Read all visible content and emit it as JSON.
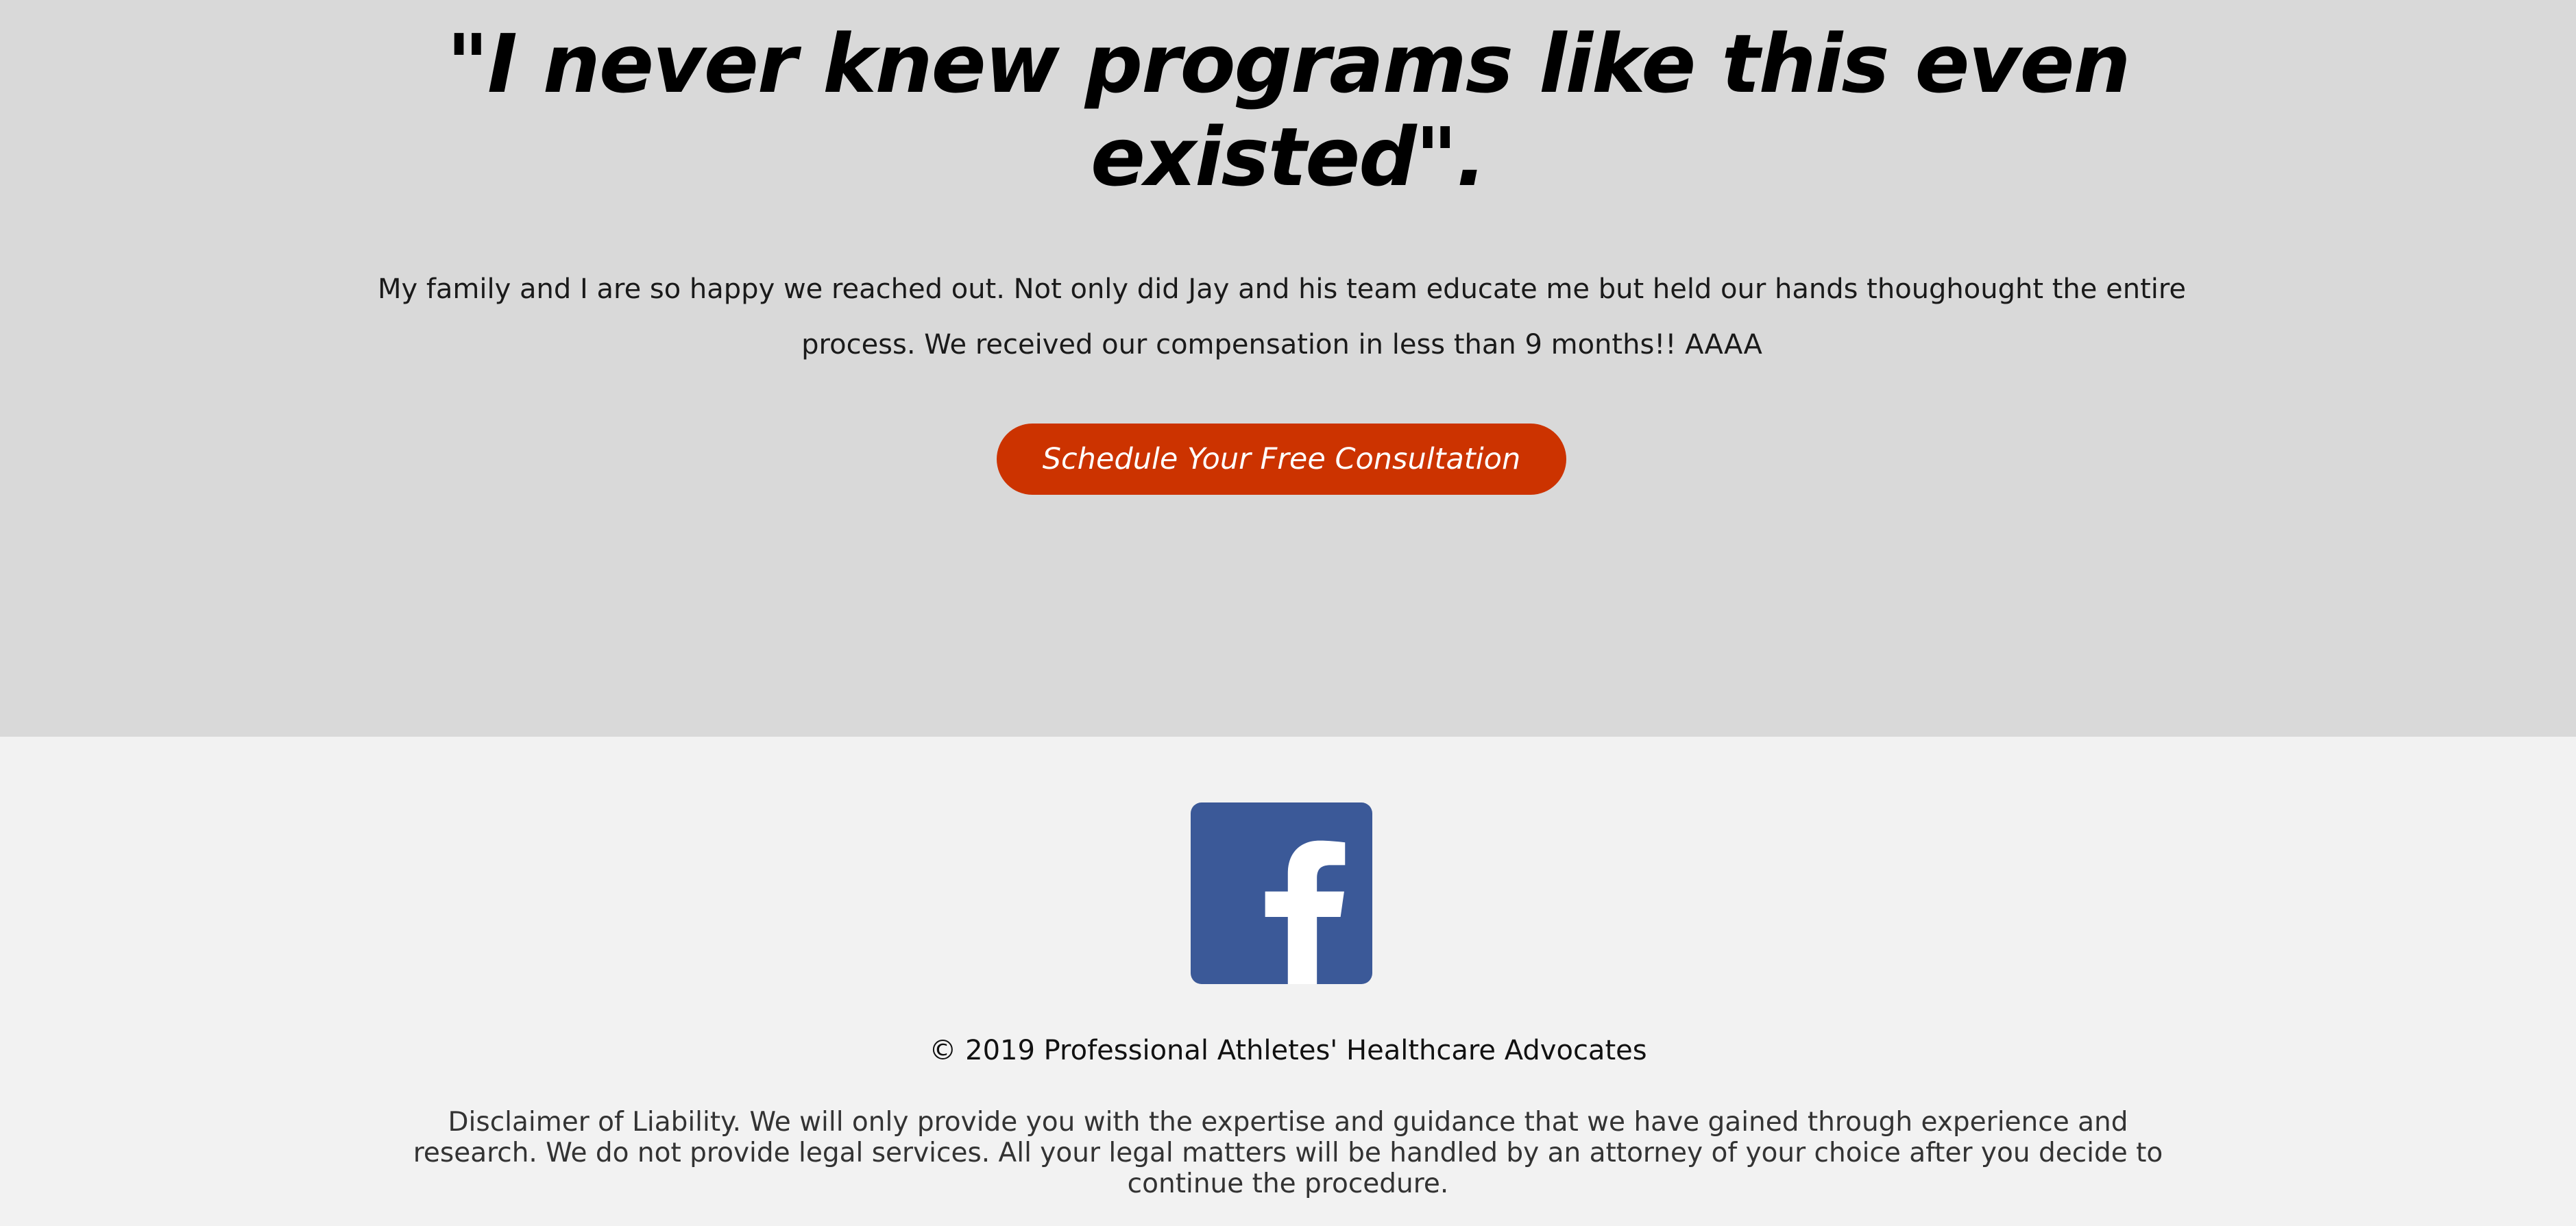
{
  "testimonial": {
    "quote_title": "\"I never knew programs like this even existed\".",
    "quote_body": "My family and I are so happy we reached out. Not only did Jay and his team educate me but held our hands thoughought the entire process. We received our compensation in less than 9 months!!  AAAA",
    "cta_label": "Schedule Your Free Consultation"
  },
  "footer": {
    "social_icon": "facebook-icon",
    "copyright": "© 2019 Professional Athletes' Healthcare Advocates",
    "disclaimer": "Disclaimer of Liability. We will only provide you with the expertise and guidance that we have gained through experience and research. We do not provide legal services. All your legal matters will be handled by an attorney of your choice after you decide to continue the procedure."
  },
  "colors": {
    "testimonial_background": "#d9d9d9",
    "footer_background": "#f2f2f2",
    "cta_background": "#cc3300",
    "facebook_blue": "#3b5998"
  }
}
